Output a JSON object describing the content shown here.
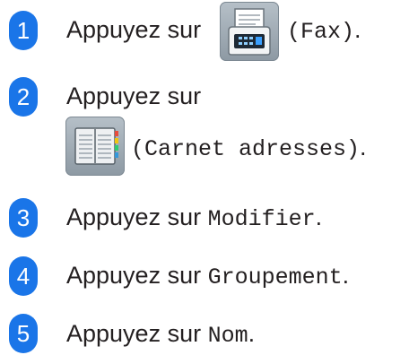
{
  "steps": [
    {
      "number": "1",
      "prefix": "Appuyez sur",
      "label": "(Fax)",
      "suffix": ".",
      "icon": "fax-icon"
    },
    {
      "number": "2",
      "prefix": "Appuyez sur",
      "label": "(Carnet adresses)",
      "suffix": ".",
      "icon": "address-book-icon"
    },
    {
      "number": "3",
      "prefix": "Appuyez sur",
      "label": "Modifier",
      "suffix": "."
    },
    {
      "number": "4",
      "prefix": "Appuyez sur",
      "label": "Groupement",
      "suffix": "."
    },
    {
      "number": "5",
      "prefix": "Appuyez sur",
      "label": "Nom",
      "suffix": "."
    }
  ],
  "colors": {
    "step_badge": "#1a75e8",
    "text": "#231f20",
    "icon_bg": "#a3adb6"
  }
}
